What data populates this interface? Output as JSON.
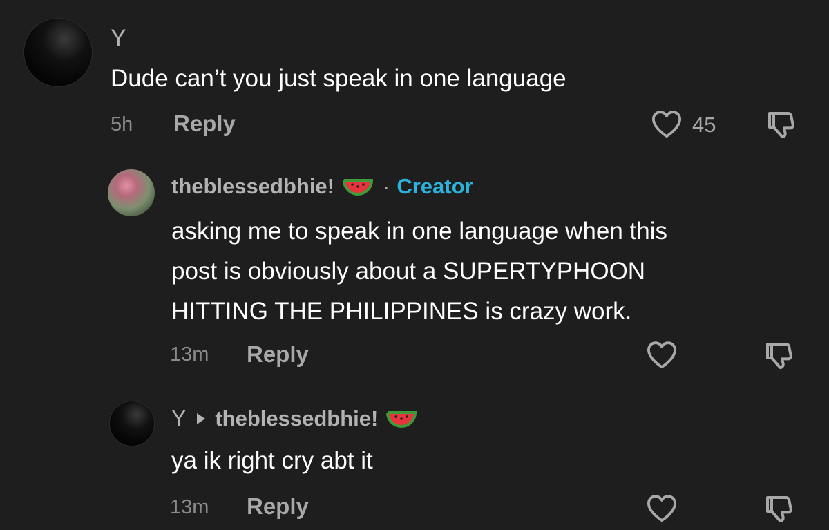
{
  "comments": [
    {
      "username": "Y",
      "text": "Dude can’t you just speak in one language",
      "time": "5h",
      "reply_label": "Reply",
      "likes": "45"
    },
    {
      "username": "theblessedbhie!",
      "badge": "Creator",
      "badge_separator": "·",
      "text_lines": [
        "asking me to speak in one language when this",
        "post is obviously about a SUPERTYPHOON",
        "HITTING THE PHILIPPINES is crazy work."
      ],
      "time": "13m",
      "reply_label": "Reply"
    },
    {
      "username": "Y",
      "reply_to": "theblessedbhie!",
      "text": "ya ik right cry abt it",
      "time": "13m",
      "reply_label": "Reply"
    }
  ],
  "icons": {
    "like": "heart-outline-icon",
    "dislike": "thumbs-down-outline-icon",
    "emoji": "watermelon-emoji",
    "reply_arrow": "play-arrow-icon"
  },
  "colors": {
    "background": "#1e1e1e",
    "creator_badge": "#2bb3de",
    "username": "#b3b3b3",
    "meta": "#8a8a8a"
  }
}
